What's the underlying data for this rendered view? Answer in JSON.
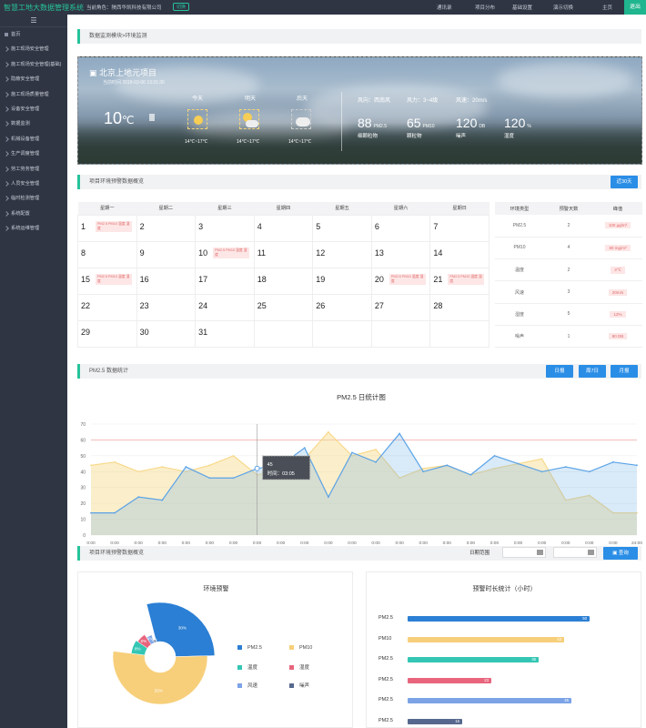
{
  "topbar": {
    "logo": "智慧工地大数据管理系统",
    "role": "当前角色：陕西华凯科技有限公司",
    "switch": "切换",
    "nav": [
      "通讯录",
      "项目分布",
      "基础设置",
      "演示切换",
      "主页"
    ],
    "exit": "退出"
  },
  "sidebar": {
    "home": "首页",
    "items": [
      "施工现场安全管理",
      "施工现场安全管理(基础)",
      "隐蔽安全管理",
      "施工现场质量管理",
      "设备安全管理",
      "数据监测",
      "机械设备管理",
      "生产调度管理",
      "劳工劳务管理",
      "人员安全管理",
      "临时检测管理",
      "系统配置",
      "系统运维管理"
    ]
  },
  "breadcrumb": "数据监测模块>环境监测",
  "weather": {
    "project": "北京上地元项目",
    "time": "当前时间 2018-03-06 13:31:30",
    "temp": "10",
    "unit": "℃",
    "days": [
      {
        "label": "今天",
        "range": "14℃~17℃"
      },
      {
        "label": "明天",
        "range": "14℃~17℃"
      },
      {
        "label": "后天",
        "range": "14℃~17℃"
      }
    ],
    "wind": [
      {
        "k": "风向：",
        "v": "西南风"
      },
      {
        "k": "风力：",
        "v": "3~4级"
      },
      {
        "k": "风速：",
        "v": "20m/s"
      }
    ],
    "metrics": [
      {
        "value": "88",
        "unit": "PM2.5",
        "label": "细颗粒物"
      },
      {
        "value": "65",
        "unit": "PM10",
        "label": "颗粒物"
      },
      {
        "value": "120",
        "unit": "DB",
        "label": "噪声"
      },
      {
        "value": "120",
        "unit": "%",
        "label": "湿度"
      }
    ]
  },
  "calendar_section": {
    "title": "项目环境预警数据概览",
    "button": "近30天",
    "weekdays": [
      "星期一",
      "星期二",
      "星期三",
      "星期四",
      "星期五",
      "星期六",
      "星期日"
    ],
    "weeks": [
      [
        "1",
        "2",
        "3",
        "4",
        "5",
        "6",
        "7"
      ],
      [
        "8",
        "9",
        "10",
        "11",
        "12",
        "13",
        "14"
      ],
      [
        "15",
        "16",
        "17",
        "18",
        "19",
        "20",
        "21"
      ],
      [
        "22",
        "23",
        "24",
        "25",
        "26",
        "27",
        "28"
      ],
      [
        "29",
        "30",
        "31",
        "",
        "",
        "",
        ""
      ]
    ],
    "tag_text": "PM2.5  PM10  温度   湿度"
  },
  "stats": {
    "headers": [
      "环境类型",
      "预警天数",
      "峰值"
    ],
    "rows": [
      [
        "PM2.5",
        "2",
        "100 µg/m³"
      ],
      [
        "PM10",
        "4",
        "80 mg/m³"
      ],
      [
        "温度",
        "2",
        "3℃"
      ],
      [
        "风速",
        "3",
        "20m/s"
      ],
      [
        "湿度",
        "5",
        "12%"
      ],
      [
        "噪声",
        "1",
        "80 DB"
      ]
    ]
  },
  "pm_section": {
    "title": "PM2.5 数据统计",
    "buttons": [
      "日报",
      "周7日",
      "月报"
    ]
  },
  "chart_data": {
    "type": "area",
    "title": "PM2.5   日统计图",
    "ylim": [
      0,
      70
    ],
    "yticks": [
      "0",
      "10",
      "20",
      "30",
      "40",
      "50",
      "60",
      "70"
    ],
    "x": [
      "0:00",
      "0:00",
      "0:00",
      "0:00",
      "0:00",
      "0:00",
      "0:00",
      "0:00",
      "0:00",
      "0:00",
      "0:00",
      "0:00",
      "0:00",
      "0:00",
      "0:00",
      "0:00",
      "0:00",
      "0:00",
      "0:00",
      "0:00",
      "0:00",
      "0:00",
      "0:00",
      "24:00"
    ],
    "series": [
      {
        "values": [
          44,
          46,
          40,
          43,
          40,
          44,
          50,
          38,
          42,
          48,
          65,
          50,
          54,
          36,
          42,
          44,
          38,
          42,
          45,
          48,
          22,
          25,
          14,
          14
        ],
        "color": "#f7d98a"
      },
      {
        "values": [
          14,
          14,
          24,
          22,
          43,
          36,
          36,
          42,
          44,
          55,
          24,
          52,
          46,
          64,
          40,
          44,
          38,
          50,
          45,
          40,
          43,
          40,
          46,
          44
        ],
        "color": "#5aa3e6"
      }
    ],
    "tooltip": {
      "value": "45",
      "time": "时间：03:05"
    }
  },
  "overview": {
    "title": "项目环境预警数据概览",
    "date_label": "日期范围",
    "search": "查询"
  },
  "pie": {
    "title": "环境预警",
    "slices": [
      {
        "name": "PM2.5",
        "pct": "30%",
        "color": "#2b7fd4",
        "value": 30
      },
      {
        "name": "PM10",
        "pct": "55%",
        "color": "#f7cf7a",
        "value": 55
      },
      {
        "name": "温度",
        "pct": "8%",
        "color": "#33c6b4",
        "value": 8
      },
      {
        "name": "湿度",
        "pct": "6%",
        "color": "#e8657d",
        "value": 6
      },
      {
        "name": "风速",
        "pct": "4%",
        "color": "#7ba3e6",
        "value": 4
      },
      {
        "name": "噪声",
        "pct": "2%",
        "color": "#56688e",
        "value": 2
      }
    ]
  },
  "bars": {
    "title": "预警时长统计（小时）",
    "items": [
      {
        "name": "PM2.5",
        "value": 50,
        "color": "#2b7fd4"
      },
      {
        "name": "PM10",
        "value": 43,
        "color": "#f7cf7a"
      },
      {
        "name": "PM2.5",
        "value": 36,
        "color": "#33c6b4"
      },
      {
        "name": "PM2.5",
        "value": 23,
        "color": "#e8657d"
      },
      {
        "name": "PM2.5",
        "value": 45,
        "color": "#7ba3e6"
      },
      {
        "name": "PM2.5",
        "value": 15,
        "color": "#56688e"
      }
    ]
  }
}
